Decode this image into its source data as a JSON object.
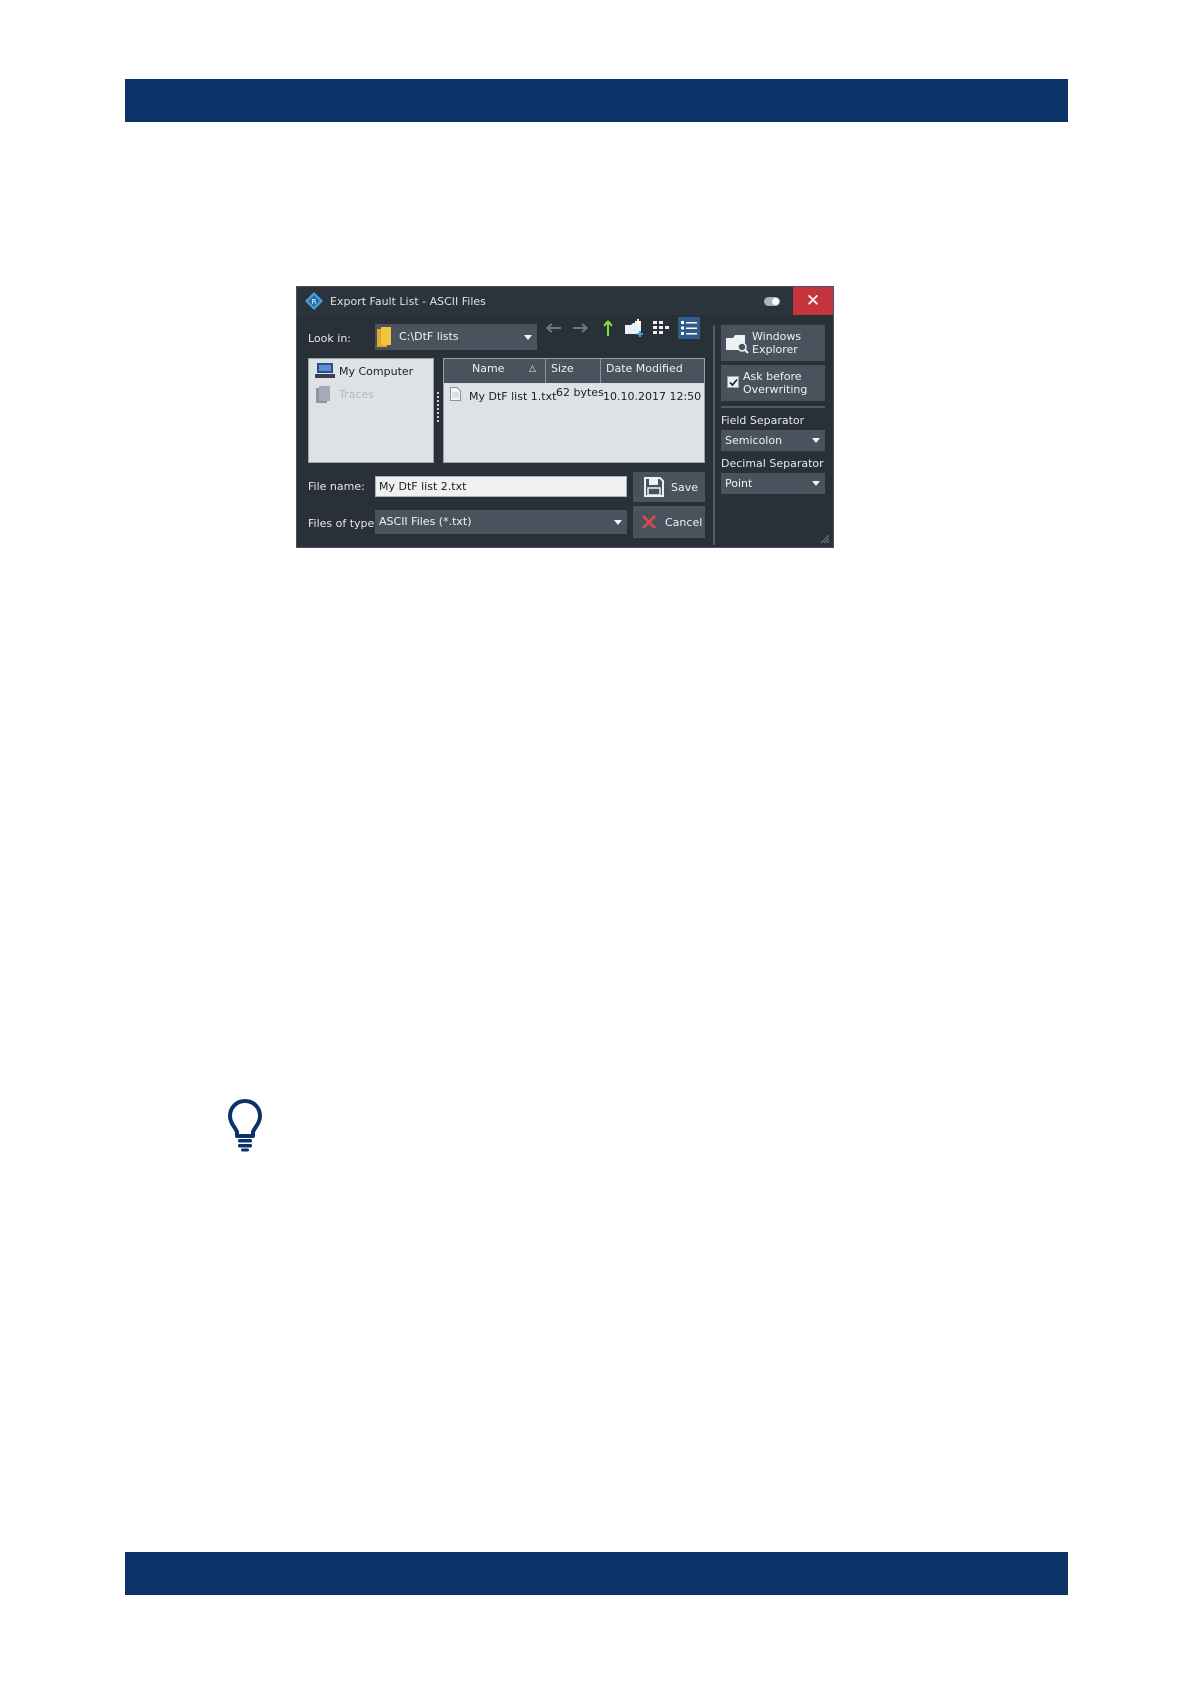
{
  "dialog": {
    "title": "Export Fault List - ASCII Files",
    "look_in_label": "Look in:",
    "look_in_value": "C:\\DtF lists",
    "places": [
      "My Computer",
      "Traces"
    ],
    "columns": {
      "name": "Name",
      "size": "Size",
      "date": "Date Modified"
    },
    "files": [
      {
        "name": "My DtF list 1.txt",
        "size": "62 bytes",
        "date": "10.10.2017 12:50"
      }
    ],
    "file_name_label": "File name:",
    "file_name_value": "My DtF list 2.txt",
    "files_of_type_label": "Files of type:",
    "files_of_type_value": "ASCII Files (*.txt)",
    "save_label": "Save",
    "cancel_label": "Cancel",
    "windows_explorer_line1": "Windows",
    "windows_explorer_line2": "Explorer",
    "ask_before_line1": "Ask before",
    "ask_before_line2": "Overwriting",
    "ask_before_checked": true,
    "field_separator_label": "Field Separator",
    "field_separator_value": "Semicolon",
    "decimal_separator_label": "Decimal Separator",
    "decimal_separator_value": "Point"
  },
  "colors": {
    "band": "#0c3368",
    "dialog_bg": "#293038",
    "close_red": "#c3343c",
    "up_arrow_green": "#7fe33a"
  },
  "icons": [
    "app-logo-icon",
    "close-icon",
    "folder-icon",
    "back-arrow-icon",
    "forward-arrow-icon",
    "up-arrow-icon",
    "new-folder-icon",
    "list-view-icon",
    "detail-view-icon",
    "computer-icon",
    "traces-icon",
    "document-icon",
    "save-icon",
    "cancel-icon",
    "windows-explorer-icon",
    "checkbox-icon",
    "lightbulb-icon"
  ]
}
